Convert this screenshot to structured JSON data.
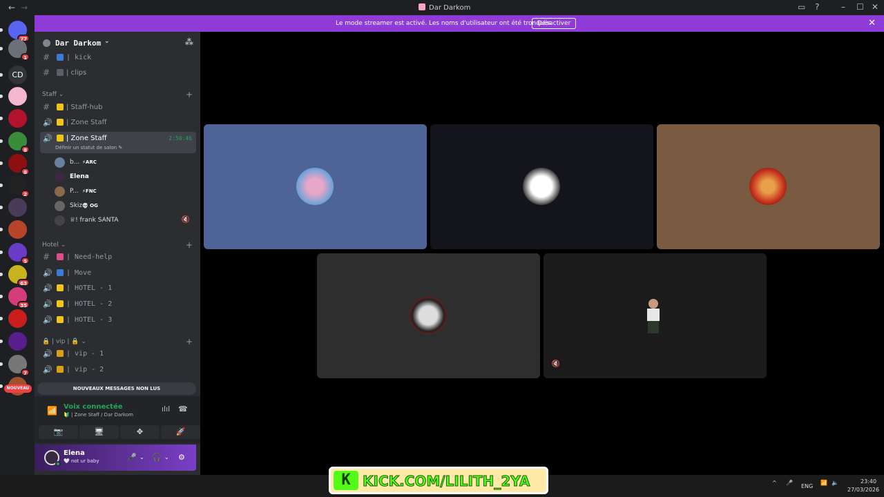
{
  "window": {
    "title": "Dar Darkom",
    "back": "←",
    "forward": "→"
  },
  "banner": {
    "message": "Le mode streamer est activé. Les noms d'utilisateur ont été tronqués.",
    "button": "Désactiver",
    "close": "✕"
  },
  "servers": [
    {
      "badge": "77",
      "color": "#5865f2"
    },
    {
      "badge": "1",
      "color": "#6b6f78"
    },
    {
      "label": "CD",
      "color": "#313338"
    },
    {
      "badge": "",
      "color": "#f5b6cf"
    },
    {
      "badge": "",
      "color": "#b3122b"
    },
    {
      "badge": "8",
      "color": "#3a8c3a"
    },
    {
      "badge": "8",
      "color": "#8c1010"
    },
    {
      "badge": "2",
      "color": "#222"
    },
    {
      "badge": "",
      "color": "#4a3b5a"
    },
    {
      "badge": "",
      "color": "#b6442a"
    },
    {
      "badge": "5",
      "color": "#6a3bc7"
    },
    {
      "badge": "63",
      "color": "#c8b21e"
    },
    {
      "badge": "35",
      "color": "#d43c7a"
    },
    {
      "badge": "",
      "color": "#c81e1e"
    },
    {
      "badge": "",
      "color": "#5a1e8c"
    },
    {
      "badge": "7",
      "color": "#777"
    },
    {
      "badge": "",
      "color": "#a0522d"
    }
  ],
  "nouveau": "NOUVEAU",
  "guild": {
    "name": "Dar Darkom",
    "chevron": "⌄",
    "invite_icon": "⁂"
  },
  "channels": {
    "top": [
      {
        "hash": "#",
        "name": "| kick",
        "emoji": "#3a7bd5"
      },
      {
        "hash": "#",
        "name": "| clips",
        "emoji": "#5c5f66"
      }
    ],
    "staff_cat": "Staff ⌄",
    "staff": [
      {
        "icon": "#",
        "name": "| Staff-hub",
        "emoji": "#f0c419"
      },
      {
        "icon": "🔊",
        "name": "| Zone Staff",
        "emoji": "#f0c419"
      }
    ],
    "active": {
      "name": "| Zone Staff",
      "timer": "2:50:46",
      "status": "Définir un statut de salon ✎"
    },
    "voice_users": [
      {
        "name": "b...",
        "tag": "⚡ARC",
        "color": "#6b7fa0"
      },
      {
        "name": "Elena",
        "tag": "",
        "color": "#3b2a3f"
      },
      {
        "name": "P...",
        "tag": "⚡FNC",
        "color": "#8a6a4a"
      },
      {
        "name": "Skizo",
        "tag": "💀 OG",
        "color": "#666"
      },
      {
        "name": "♕! frank SANTA",
        "tag": "",
        "color": "#444",
        "deaf": "🔇"
      }
    ],
    "hotel_cat": "Hotel ⌄",
    "hotel": [
      {
        "icon": "#",
        "name": "| Need-help",
        "emoji": "#e04c8c"
      },
      {
        "icon": "🔊",
        "name": "| Move",
        "emoji": "#3a7bd5"
      },
      {
        "icon": "🔊",
        "name": "| HOTEL - 1",
        "emoji": "#f0c419"
      },
      {
        "icon": "🔊",
        "name": "| HOTEL - 2",
        "emoji": "#f0c419"
      },
      {
        "icon": "🔊",
        "name": "| HOTEL - 3",
        "emoji": "#f0c419"
      }
    ],
    "vip_cat": "🔒 | vip | 🔒 ⌄",
    "vip": [
      {
        "icon": "🔊",
        "name": "| vip - 1",
        "emoji": "#d4a017"
      },
      {
        "icon": "🔊",
        "name": "| vip - 2",
        "emoji": "#d4a017"
      }
    ],
    "plus": "+"
  },
  "unread": "NOUVEAUX MESSAGES NON LUS",
  "voice": {
    "status": "Voix connectée",
    "channel": "🔰 | Zone Staff / Dar Darkom",
    "icon": "📶",
    "wave": "ılıl",
    "hangup": "☎",
    "buttons": [
      "📷",
      "🖥",
      "✥",
      "🚀"
    ]
  },
  "user": {
    "name": "Elena",
    "status": "🤍 not ur baby",
    "mic": "🎤",
    "headset": "🎧",
    "gear": "⚙",
    "caret": "⌄"
  },
  "tiles": [
    {
      "bg": "#4e6496",
      "avatar": "#e8a6c8"
    },
    {
      "bg": "#14141c",
      "avatar": "#f2f2f2"
    },
    {
      "bg": "#7a5a40",
      "avatar": "#d9461e"
    },
    {
      "bg": "#2e2e2e",
      "avatar": "#ddd"
    },
    {
      "bg": "#1c1c1c",
      "avatar": "none",
      "mute": "🔇"
    }
  ],
  "taskbar": {
    "lang": "ENG",
    "time": "23:40",
    "date": "27/03/2026",
    "tray": "^",
    "mic": "🎤",
    "wifi": "📶",
    "vol": "🔈"
  },
  "overlay": {
    "k": "K",
    "url": "KICK.COM/LILITH_2YA"
  }
}
